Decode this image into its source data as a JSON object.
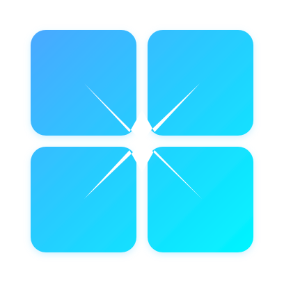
{
  "icon": {
    "name": "four-tile-starburst-logo",
    "description_icon": "tiles-with-sparkle-icon"
  },
  "colors": {
    "background": "#ffffff",
    "gradient_start": "#4aa7ff",
    "gradient_end": "#00f6ff",
    "sparkle": "#ffffff",
    "shadow": "#7fd7ff"
  }
}
